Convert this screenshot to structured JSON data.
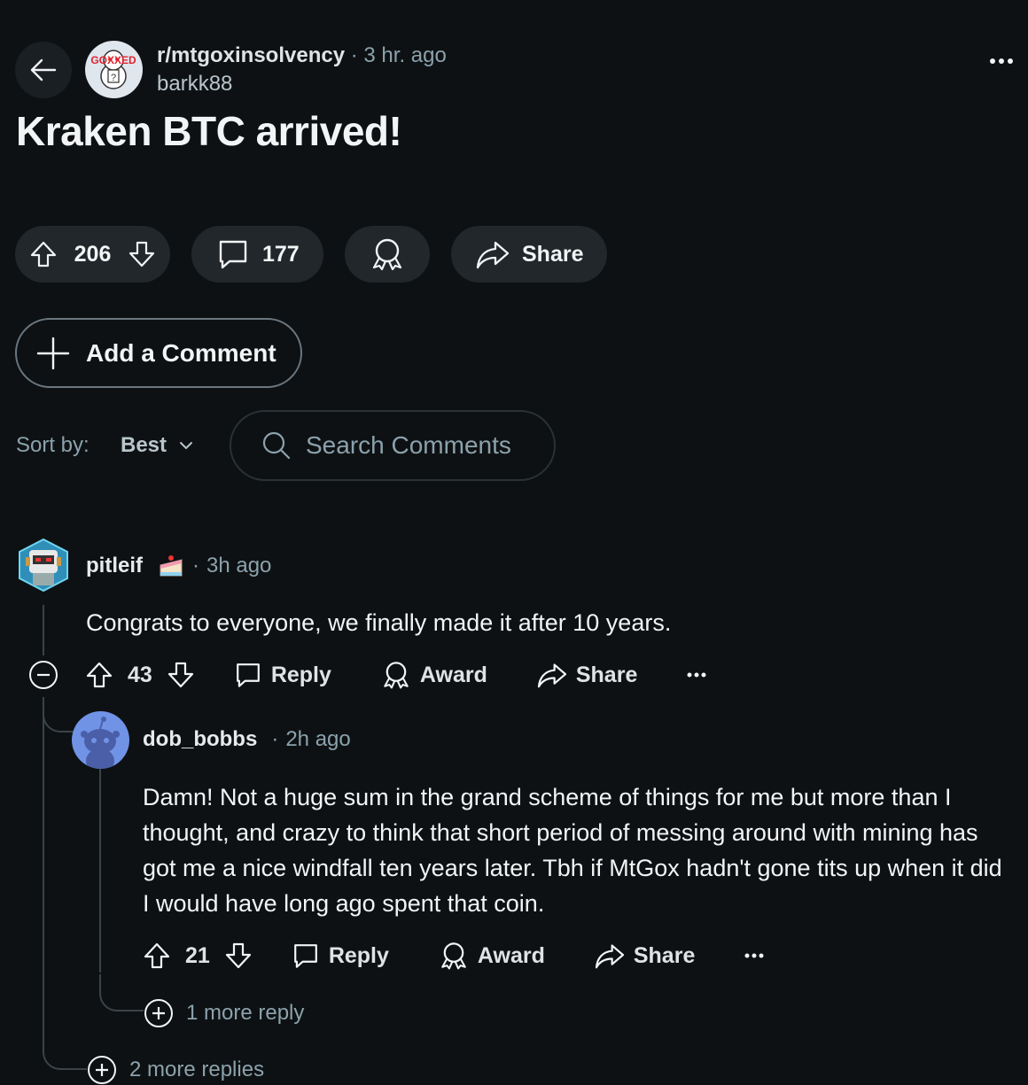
{
  "post": {
    "subreddit": "r/mtgoxinsolvency",
    "time": "3 hr. ago",
    "author": "barkk88",
    "title": "Kraken BTC arrived!",
    "avatar_text": "GOXXED",
    "votes": "206",
    "comments": "177",
    "share_label": "Share"
  },
  "add_comment_label": "Add a Comment",
  "sort": {
    "label": "Sort by:",
    "value": "Best"
  },
  "search": {
    "placeholder": "Search Comments"
  },
  "comments": [
    {
      "user": "pitleif",
      "time": "3h ago",
      "body": "Congrats to everyone, we finally made it after 10 years.",
      "votes": "43",
      "reply": "Reply",
      "award": "Award",
      "share": "Share",
      "replies": [
        {
          "user": "dob_bobbs",
          "time": "2h ago",
          "body": "Damn! Not a huge sum in the grand scheme of things for me but more than I thought, and crazy to think that short period of messing around with mining has got me a nice windfall ten years later. Tbh if MtGox hadn't gone tits up when it did I would have long ago spent that coin.",
          "votes": "21",
          "reply": "Reply",
          "award": "Award",
          "share": "Share",
          "more_replies": "1 more reply"
        }
      ],
      "more_replies": "2 more replies"
    }
  ],
  "colors": {
    "background": "#0e1113",
    "pill": "#21272b",
    "dim_text": "#8ba2ad"
  }
}
